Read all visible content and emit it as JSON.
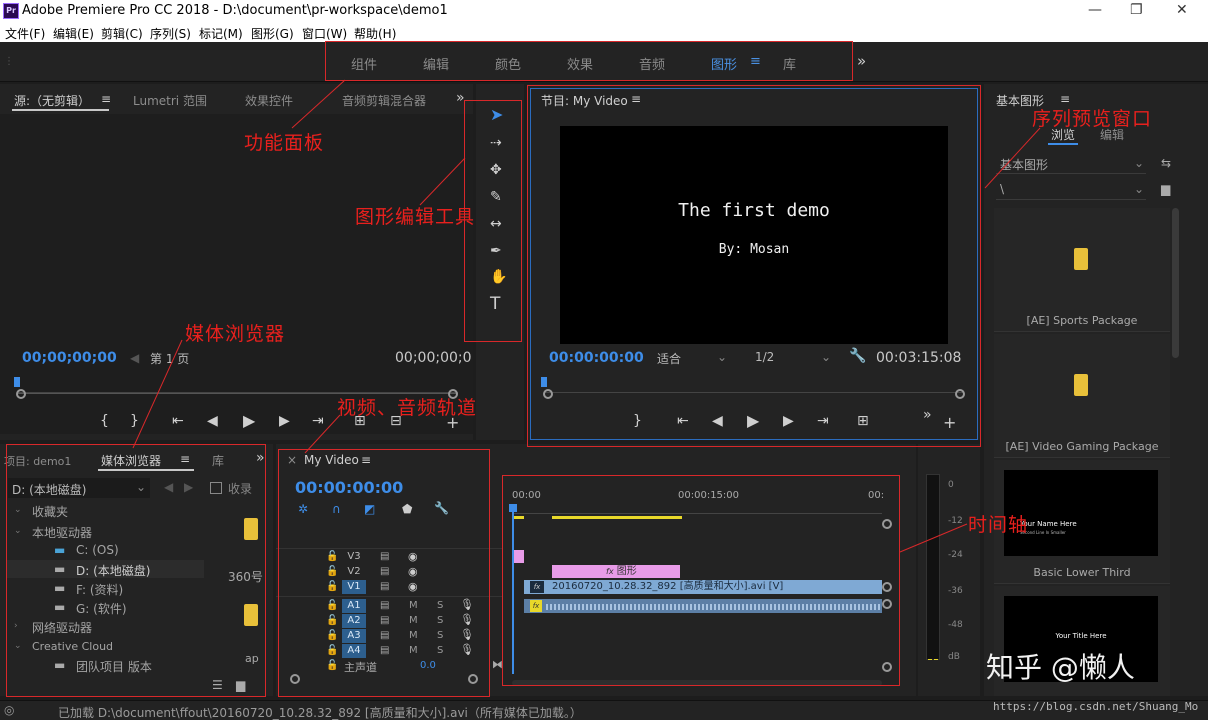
{
  "window": {
    "title": "Adobe Premiere Pro CC 2018 - D:\\document\\pr-workspace\\demo1",
    "app_icon": "Pr",
    "min": "—",
    "max": "❐",
    "close": "✕"
  },
  "menu": [
    "文件(F)",
    "编辑(E)",
    "剪辑(C)",
    "序列(S)",
    "标记(M)",
    "图形(G)",
    "窗口(W)",
    "帮助(H)"
  ],
  "workspaces": [
    "组件",
    "编辑",
    "颜色",
    "效果",
    "音频",
    "图形",
    "库"
  ],
  "workspace_active_menu": "≡",
  "workspace_more": "»",
  "source": {
    "tabs": [
      "源:（无剪辑）",
      "Lumetri 范围",
      "效果控件",
      "音频剪辑混合器"
    ],
    "menu": "≡",
    "more": "»",
    "tc_left": "00;00;00;00",
    "page": "第 1 页",
    "tc_right": "00;00;00;0"
  },
  "program": {
    "tab": "节目: My Video",
    "menu": "≡",
    "line1": "The first demo",
    "line2": "By: Mosan",
    "tc_left": "00:00:00:00",
    "fit": "适合",
    "quality": "1/2",
    "tc_right": "00:03:15:08"
  },
  "graphics": {
    "title": "基本图形",
    "menu": "≡",
    "tabs": [
      "浏览",
      "编辑"
    ],
    "select1": "基本图形",
    "select2": "\\",
    "items": [
      "[AE] Sports Package",
      "[AE] Video Gaming Package",
      "Basic Lower Third"
    ],
    "thumb1_a": "Your Name Here",
    "thumb1_b": "Second Line In Smaller",
    "thumb2": "Your Title Here"
  },
  "project": {
    "tabs": [
      "项目: demo1",
      "媒体浏览器",
      "库"
    ],
    "menu": "≡",
    "more": "»",
    "drive_select": "D: (本地磁盘)",
    "collect": "收录",
    "tree": [
      "收藏夹",
      "本地驱动器",
      "C: (OS)",
      "D: (本地磁盘)",
      "F: (资料)",
      "G: (软件)",
      "网络驱动器",
      "Creative Cloud",
      "团队项目 版本"
    ],
    "file1": "360号",
    "file2": "ap"
  },
  "timeline": {
    "close": "×",
    "tab": "My Video",
    "menu": "≡",
    "tc": "00:00:00:00",
    "ruler": [
      "00:00",
      "00:00:15:00",
      "00:"
    ],
    "tracks": [
      "V3",
      "V2",
      "V1",
      "A1",
      "A2",
      "A3",
      "A4"
    ],
    "mute": "M",
    "solo": "S",
    "master": "主声道",
    "master_val": "0.0",
    "clip_graphic": "图形",
    "clip_video": "20160720_10.28.32_892 [高质量和大小].avi [V]",
    "fx": "fx"
  },
  "meter": {
    "ticks": [
      "0",
      "-12",
      "-24",
      "-36",
      "-48",
      "dB"
    ]
  },
  "annotations": {
    "func_panel": "功能面板",
    "tools": "图形编辑工具",
    "media_browser": "媒体浏览器",
    "tracks": "视频、音频轨道",
    "timeline": "时间轴",
    "preview": "序列预览窗口"
  },
  "watermark": {
    "zh": "知乎 @懒人",
    "url": "https://blog.csdn.net/Shuang_Mo"
  },
  "status": "已加载 D:\\document\\ffout\\20160720_10.28.32_892 [高质量和大小].avi（所有媒体已加载。）"
}
